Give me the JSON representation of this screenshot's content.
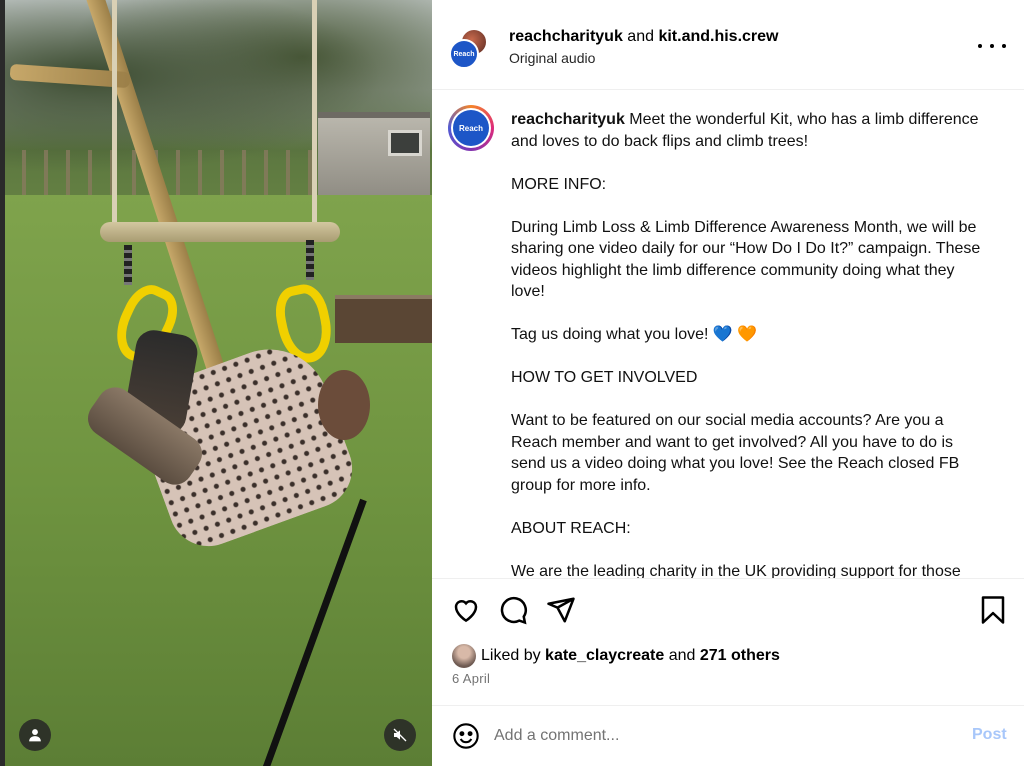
{
  "media": {
    "icons": {
      "user_tag": "user-tag-icon",
      "mute": "speaker-muted-icon"
    }
  },
  "header": {
    "author_primary": "reachcharityuk",
    "connector": "and",
    "author_secondary": "kit.and.his.crew",
    "audio_label": "Original audio",
    "avatar_text": "Reach"
  },
  "caption": {
    "username": "reachcharityuk",
    "intro": "Meet the wonderful Kit, who has a limb difference and loves to do back flips and climb trees!",
    "section_more_info": "MORE INFO:",
    "paragraph_campaign": "During Limb Loss & Limb Difference Awareness Month, we will be sharing one video daily for our “How Do I Do It?” campaign. These videos highlight the limb difference community doing what they love!",
    "tag_line": "Tag us doing what you love!",
    "emoji_blue_heart": "💙",
    "emoji_orange_heart": "🧡",
    "section_get_involved": "HOW TO GET INVOLVED",
    "paragraph_involved": "Want to be featured on our social media accounts? Are you a Reach member and want to get involved? All you have to do is send us a video doing what you love! See the Reach closed FB group for more info.",
    "section_about": "ABOUT REACH:",
    "paragraph_about": "We are the leading charity in the UK providing support for those"
  },
  "likes": {
    "prefix": "Liked by",
    "user": "kate_claycreate",
    "connector": "and",
    "others": "271 others"
  },
  "date": "6 April",
  "comment": {
    "placeholder": "Add a comment...",
    "post_label": "Post"
  },
  "colors": {
    "brand_blue": "#1d56c7",
    "post_disabled": "#a8c7fa",
    "muted_text": "#737373"
  }
}
